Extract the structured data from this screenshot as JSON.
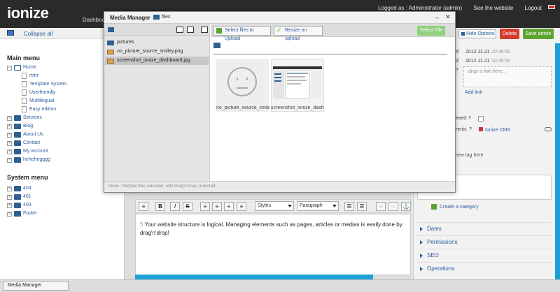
{
  "header": {
    "logo": "ionize",
    "dashboard_tab": "Dashboard",
    "logged_as": "Logged as : Administrator (admin)",
    "see_website": "See the website",
    "logout": "Logout"
  },
  "sidebar": {
    "collapse_all": "Collapse all",
    "main_menu_title": "Main menu",
    "home": "Home",
    "home_children": [
      "rtrtrr",
      "Template System",
      "Userfriendly",
      "Multilingual",
      "Easy edition"
    ],
    "main_items": [
      "Services",
      "Blog",
      "About Us",
      "Contact",
      "My account",
      "hehehegggg"
    ],
    "system_menu_title": "System menu",
    "system_items": [
      "404",
      "401",
      "403",
      "Footer"
    ]
  },
  "toolbar": {
    "hide_options": "Hide Options",
    "delete": "Delete",
    "save_article": "Save article"
  },
  "right_panel": {
    "date1": "2012.11.21",
    "time1": "10:46:50",
    "date2": "2012.11.21",
    "time2": "10:46:50",
    "help_q": "?",
    "drop_link_placeholder": "drop a link here...",
    "add_link": "Add link",
    "indexed_label": "exed",
    "parents_label": "rents",
    "ionize_cms": "Ionize CMS",
    "new_tag_label": "new tag here",
    "create_category": "Create a category",
    "accordions": [
      "Dates",
      "Permissions",
      "SEO",
      "Operations"
    ]
  },
  "editor": {
    "styles_select": "Styles",
    "paragraph_select": "Paragraph",
    "bold": "B",
    "italic": "I",
    "strike": "S",
    "paragraph_mark": "¶",
    "text": "Your website structure is logical. Managing elements such as pages, articles or medias is easily done by drag'n'drop!"
  },
  "modal": {
    "title": "Media Manager",
    "folder": "files",
    "select_files_btn": "Select files to Upload",
    "resize_btn": "Resize on upload",
    "select_file_btn": "Select File",
    "files": [
      "pictures",
      "no_picture_source_smiley.png",
      "screenshot_ionize_dashboard.jpg"
    ],
    "thumb1_name": "no_picture_source_smiley",
    "thumb2_name": "screenshot_ionize_dashb",
    "footer_text": "Mode : Multiple files selection, with Drag'n'Drop, Autostart",
    "min_icon": "–",
    "close_icon": "✕"
  },
  "taskbar": {
    "media_manager": "Media Manager"
  },
  "colors": {
    "accent_blue": "#1ea0d6",
    "delete_red": "#d63b2f",
    "save_green": "#5da42f",
    "link_blue": "#2b5c9e"
  }
}
